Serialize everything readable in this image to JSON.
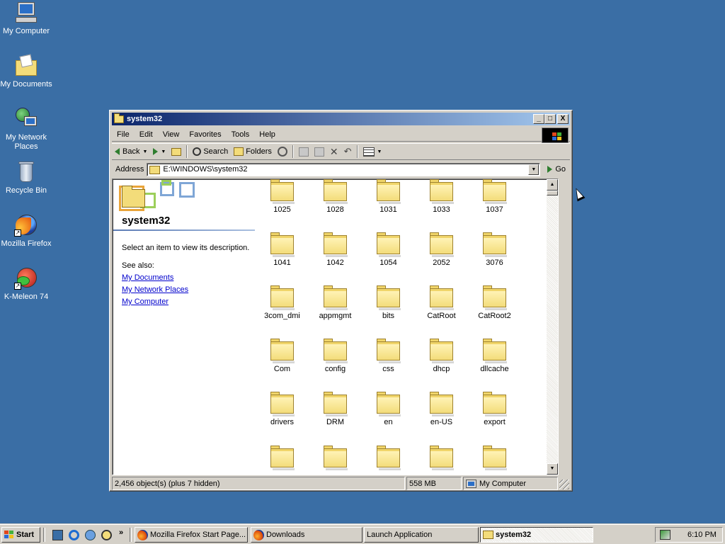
{
  "desktop": {
    "icons": [
      {
        "label": "My Computer"
      },
      {
        "label": "My Documents"
      },
      {
        "label": "My Network Places"
      },
      {
        "label": "Recycle Bin"
      },
      {
        "label": "Mozilla Firefox"
      },
      {
        "label": "K-Meleon 74"
      }
    ],
    "background_color": "#3A6EA5"
  },
  "window": {
    "title": "system32",
    "title_buttons": {
      "minimize": "_",
      "maximize": "□",
      "close": "X"
    },
    "menu": [
      "File",
      "Edit",
      "View",
      "Favorites",
      "Tools",
      "Help"
    ],
    "toolbar": {
      "back_label": "Back",
      "search_label": "Search",
      "folders_label": "Folders"
    },
    "address": {
      "label": "Address",
      "value": "E:\\WINDOWS\\system32",
      "go_label": "Go"
    },
    "left_pane": {
      "title": "system32",
      "description": "Select an item to view its description.",
      "see_also": "See also:",
      "links": [
        "My Documents",
        "My Network Places",
        "My Computer"
      ]
    },
    "folders": [
      "1025",
      "1028",
      "1031",
      "1033",
      "1037",
      "1041",
      "1042",
      "1054",
      "2052",
      "3076",
      "3com_dmi",
      "appmgmt",
      "bits",
      "CatRoot",
      "CatRoot2",
      "Com",
      "config",
      "css",
      "dhcp",
      "dllcache",
      "drivers",
      "DRM",
      "en",
      "en-US",
      "export"
    ],
    "status": {
      "objects": "2,456 object(s) (plus 7 hidden)",
      "size": "558 MB",
      "zone": "My Computer"
    }
  },
  "taskbar": {
    "start_label": "Start",
    "more_glyph": "»",
    "tasks": [
      {
        "label": "Mozilla Firefox Start Page...",
        "icon": "firefox-icon",
        "active": false
      },
      {
        "label": "Downloads",
        "icon": "firefox-icon",
        "active": false
      },
      {
        "label": "Launch Application",
        "icon": "",
        "active": false
      },
      {
        "label": "system32",
        "icon": "folder-icon",
        "active": true
      }
    ],
    "clock": "6:10 PM"
  },
  "colors": {
    "titlebar_start": "#0A246A",
    "titlebar_end": "#A6CAF0",
    "chrome": "#D4D0C8",
    "link": "#0000CC"
  }
}
